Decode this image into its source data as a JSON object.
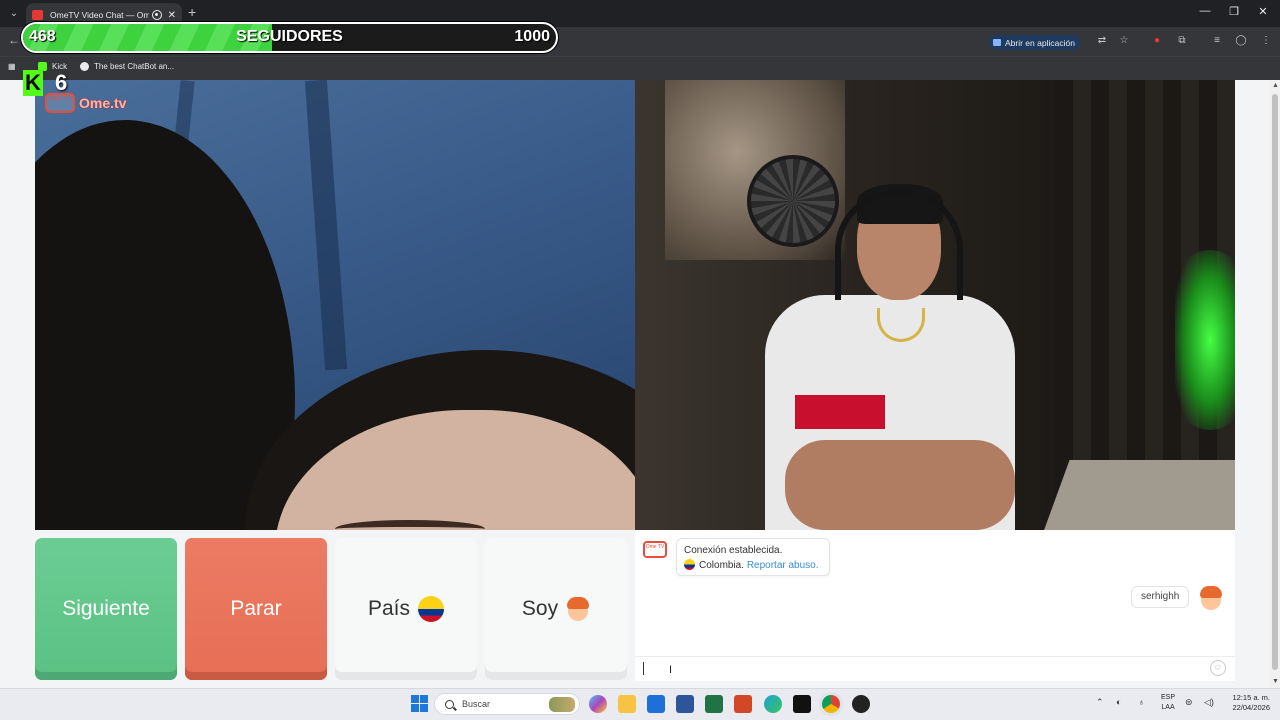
{
  "browser": {
    "tab_title": "OmeTV Video Chat — Ome",
    "open_in_app": "Abrir en aplicación",
    "bookmarks": [
      {
        "label": "Kick"
      },
      {
        "label": "The best ChatBot an..."
      }
    ]
  },
  "overlay": {
    "followers_current": "468",
    "followers_label": "SEGUIDORES",
    "followers_goal": "1000",
    "followers_progress": 0.468,
    "kick_count": "6"
  },
  "logo": {
    "tv": "Ome TV",
    "text": "Ome.tv"
  },
  "controls": {
    "next": "Siguiente",
    "stop": "Parar",
    "country": "País",
    "gender": "Soy"
  },
  "chat": {
    "system_line1": "Conexión establecida.",
    "system_country": "Colombia.",
    "report_link": "Reportar abuso.",
    "user_message": "serhighh",
    "input_value": ""
  },
  "taskbar": {
    "search_placeholder": "Buscar",
    "lang_line1": "ESP",
    "lang_line2": "LAA",
    "time": "12:15 a. m.",
    "date": "22/04/2026"
  },
  "colors": {
    "next_button": "#5ac183",
    "stop_button": "#e66e55",
    "follow_fill": "#3fd23f",
    "link": "#3a8dd0"
  }
}
